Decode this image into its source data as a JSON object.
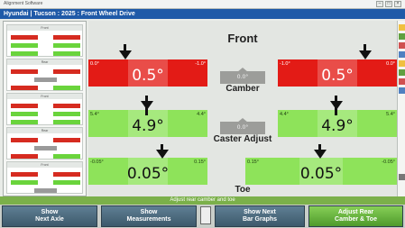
{
  "window": {
    "app_name": "Alignment Software",
    "vehicle": "Hyundai  |  Tucson : 2025 : Front Wheel Drive"
  },
  "main": {
    "axle_title": "Front",
    "camber": {
      "title": "Camber",
      "left": {
        "value": "0.5°",
        "low": "0.0°",
        "high": "-1.0°"
      },
      "right": {
        "value": "0.5°",
        "low": "-1.0°",
        "high": "0.0°"
      },
      "cross": "0.0°",
      "status_color": "#e31b16"
    },
    "caster": {
      "title": "Caster Adjust",
      "left": {
        "value": "4.9°",
        "low": "5.4°",
        "high": "4.4°"
      },
      "right": {
        "value": "4.9°",
        "low": "4.4°",
        "high": "5.4°"
      },
      "cross": "0.0°",
      "status_color": "#8ee35a"
    },
    "toe": {
      "title": "Toe",
      "left": {
        "value": "0.05°",
        "low": "-0.05°",
        "high": "0.15°"
      },
      "right": {
        "value": "0.05°",
        "low": "0.15°",
        "high": "-0.05°"
      },
      "status_color": "#8ee35a"
    }
  },
  "status": {
    "message": "Adjust rear camber and toe"
  },
  "softkeys": [
    {
      "line1": "Show",
      "line2": "Next Axle"
    },
    {
      "line1": "Show",
      "line2": "Measurements"
    },
    {
      "line1": "Show Next",
      "line2": "Bar Graphs"
    },
    {
      "line1": "Adjust Rear",
      "line2": "Camber & Toe"
    }
  ],
  "sidepanel": {
    "panels": [
      {
        "label": "Front"
      },
      {
        "label": "Rear"
      },
      {
        "label": "Front"
      },
      {
        "label": "Rear"
      },
      {
        "label": "Front"
      }
    ]
  },
  "icons": [
    "pointer-icon",
    "toolbar-icon"
  ],
  "colors": {
    "accent": "#1f5aa8",
    "ok": "#8ee35a",
    "bad": "#e31b16",
    "status": "#7bb04a",
    "active_key": "#4e9a2b"
  }
}
